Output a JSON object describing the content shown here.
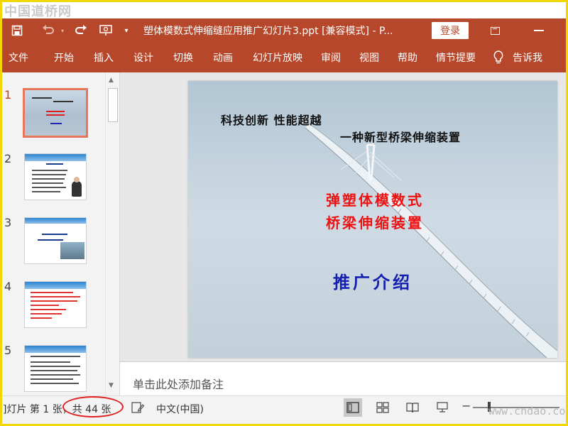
{
  "watermark_top": "中国道桥网",
  "watermark_bottom": "www.cndao.com",
  "title_bar": {
    "document_title": "塑体模数式伸缩缝应用推广幻灯片3.ppt [兼容模式] - P...",
    "login_label": "登录"
  },
  "ribbon_tabs": [
    "文件",
    "开始",
    "插入",
    "设计",
    "切换",
    "动画",
    "幻灯片放映",
    "审阅",
    "视图",
    "帮助",
    "情节提要"
  ],
  "tell_me_label": "告诉我",
  "slide_numbers": [
    "1",
    "2",
    "3",
    "4",
    "5"
  ],
  "current_slide": {
    "slogan": "科技创新 性能超越",
    "subtitle": "一种新型桥梁伸缩装置",
    "title_line_1": "弹塑体模数式",
    "title_line_2": "桥梁伸缩装置",
    "intro": "推广介绍"
  },
  "notes_placeholder": "单击此处添加备注",
  "status_bar": {
    "slide_count": "]灯片 第 1 张，共 44 张",
    "language": "中文(中国)"
  },
  "colors": {
    "accent": "#b7472a",
    "active_thumb_border": "#e8765a",
    "annotation_circle": "#e02020"
  }
}
